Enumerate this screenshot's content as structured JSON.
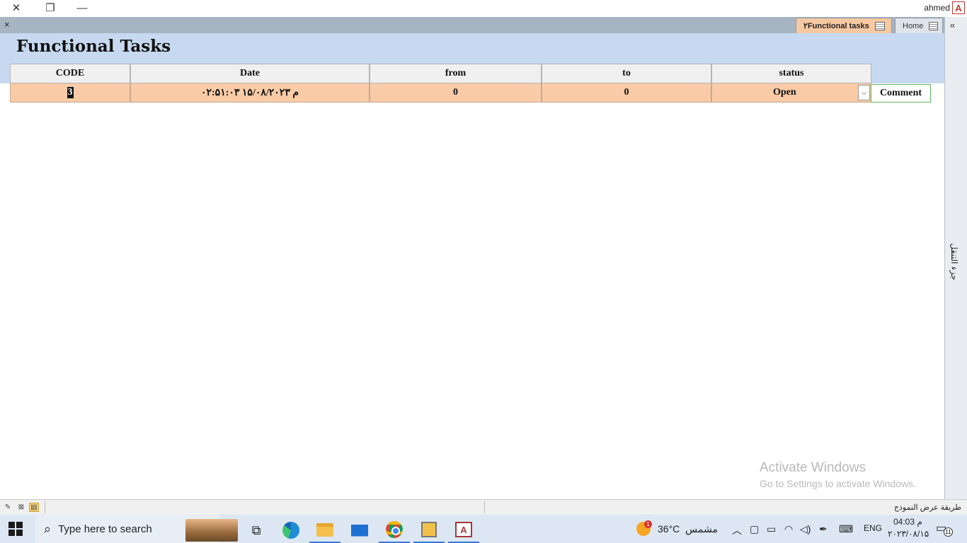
{
  "app": {
    "user": "ahmed",
    "logo_letter": "A"
  },
  "tabs": {
    "close_glyph": "×",
    "functional": "۲Functional tasks",
    "home": "Home"
  },
  "nav_pane": {
    "label": "جزء التنقل"
  },
  "form": {
    "title": "Functional Tasks",
    "columns": [
      "CODE",
      "Date",
      "from",
      "to",
      "status"
    ],
    "row": {
      "code": "3",
      "date": "۰۲:۵۱:۰۳ ۱۵/۰۸/۲۰۲۳ م",
      "from": "0",
      "to": "0",
      "status": "Open"
    },
    "comment_label": "Comment"
  },
  "watermark": {
    "line1": "Activate Windows",
    "line2": "Go to Settings to activate Windows."
  },
  "statusbar": {
    "text": "طريقة عرض النموذج"
  },
  "taskbar": {
    "search_placeholder": "Type here to search",
    "weather_temp": "36°C",
    "weather_desc": "مشمس",
    "weather_badge": "1",
    "lang": "ENG",
    "time": "04:03 م",
    "date": "۲۰۲۳/۰۸/۱۵",
    "notification_count": "11"
  },
  "colors": {
    "row_highlight": "#f9cba7",
    "form_header": "#c6d9f0",
    "active_tab": "#f7c9a2"
  }
}
